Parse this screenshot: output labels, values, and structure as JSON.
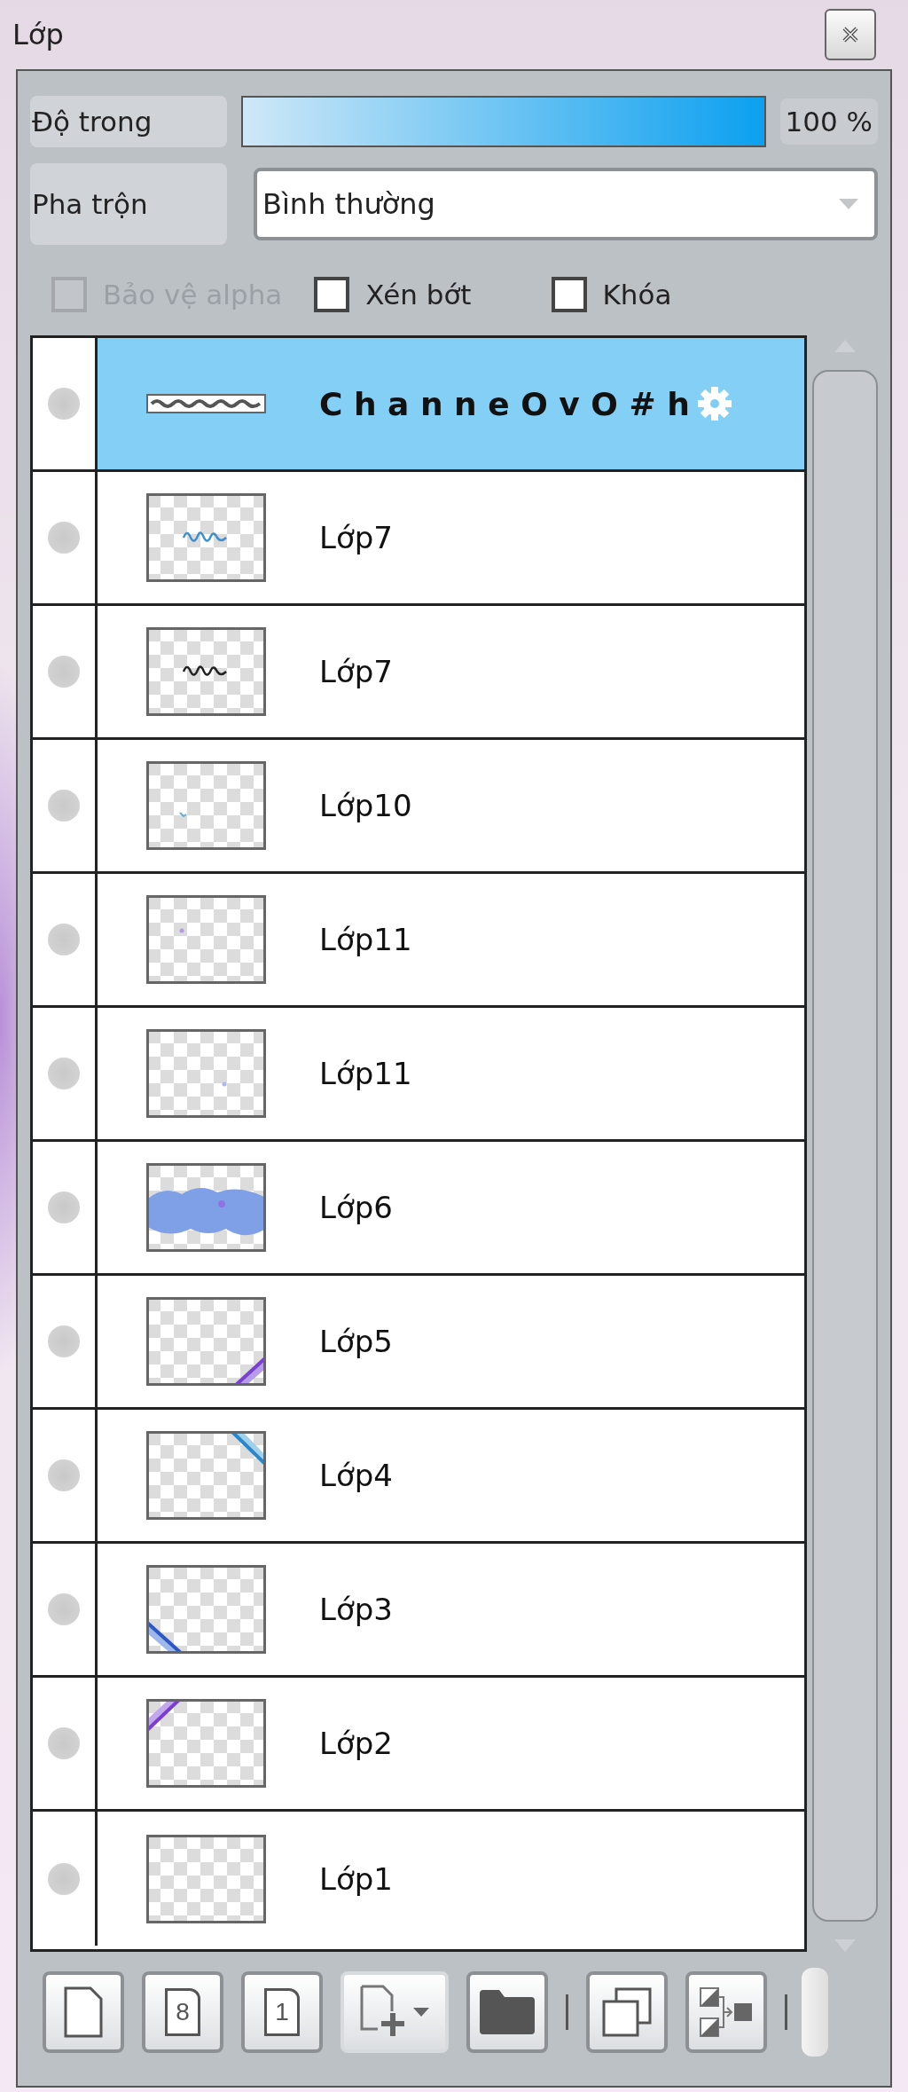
{
  "window": {
    "title": "Lớp"
  },
  "opacity": {
    "label": "Độ trong",
    "level": 1.0,
    "reading": "100 %"
  },
  "blend": {
    "label": "Pha trộn",
    "value": "Bình thường"
  },
  "options": [
    {
      "label": "Bảo vệ alpha",
      "checked": false,
      "disabled": true
    },
    {
      "label": "Xén bớt",
      "checked": false,
      "disabled": false
    },
    {
      "label": "Khóa",
      "checked": false,
      "disabled": false
    }
  ],
  "layers": [
    {
      "name": "C h a n n e O v O # h",
      "kind": "text",
      "selected": true
    },
    {
      "name": "Lớp7",
      "kind": "scribble-blue",
      "selected": false
    },
    {
      "name": "Lớp7",
      "kind": "scribble-dark",
      "selected": false
    },
    {
      "name": "Lớp10",
      "kind": "speck",
      "selected": false
    },
    {
      "name": "Lớp11",
      "kind": "dot-purple",
      "selected": false
    },
    {
      "name": "Lớp11",
      "kind": "dot-blue",
      "selected": false
    },
    {
      "name": "Lớp6",
      "kind": "cloud",
      "selected": false
    },
    {
      "name": "Lớp5",
      "kind": "corner-bottom-right",
      "selected": false
    },
    {
      "name": "Lớp4",
      "kind": "corner-top-right",
      "selected": false
    },
    {
      "name": "Lớp3",
      "kind": "corner-bottom-left",
      "selected": false
    },
    {
      "name": "Lớp2",
      "kind": "corner-top-left",
      "selected": false
    },
    {
      "name": "Lớp1",
      "kind": "empty",
      "selected": false
    }
  ],
  "toolbar": [
    {
      "kind": "new-layer"
    },
    {
      "kind": "page-number",
      "label": "8"
    },
    {
      "kind": "page-number",
      "label": "1"
    },
    {
      "kind": "add-menu"
    },
    {
      "kind": "folder"
    },
    {
      "kind": "separator"
    },
    {
      "kind": "duplicate"
    },
    {
      "kind": "merge"
    },
    {
      "kind": "separator"
    }
  ]
}
